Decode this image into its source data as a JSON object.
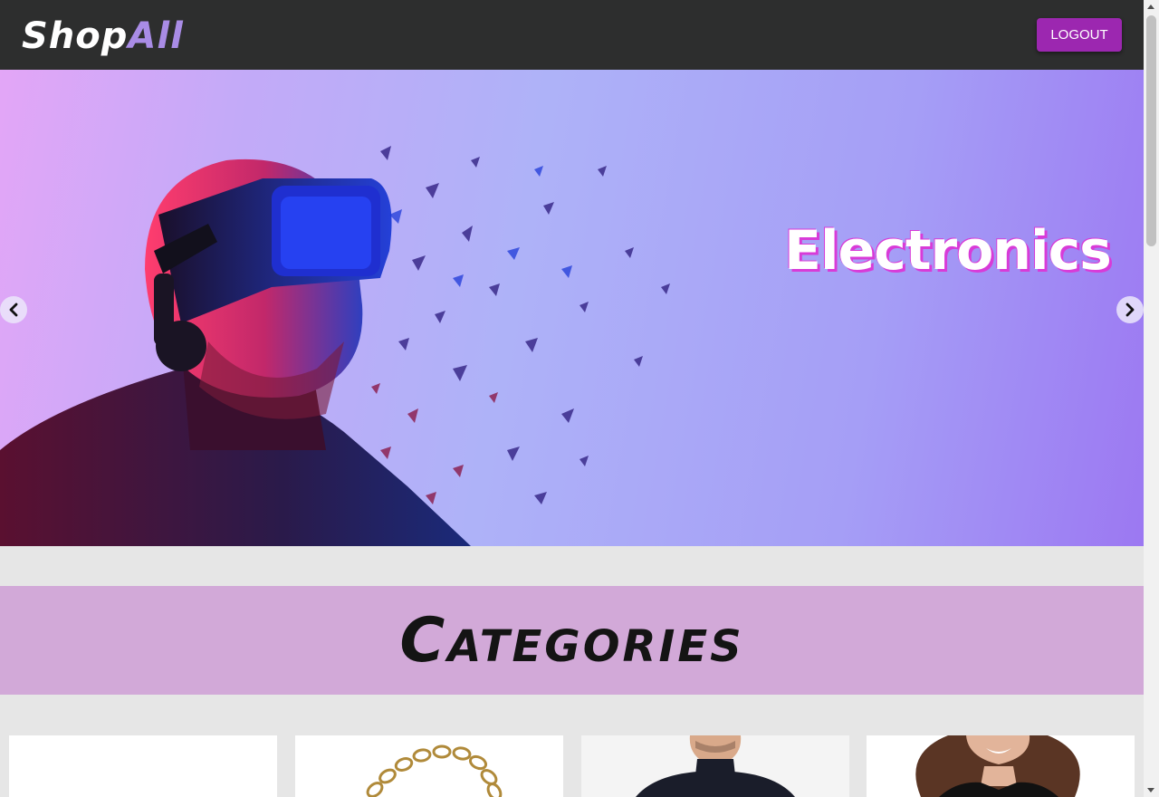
{
  "header": {
    "logo_part1": "Shop",
    "logo_part2": "All",
    "logout_label": "LOGOUT"
  },
  "hero": {
    "title": "Electronics",
    "prev_icon": "chevron-left-icon",
    "next_icon": "chevron-right-icon"
  },
  "categories": {
    "title": "Categories",
    "cards": [
      {
        "image": "blank"
      },
      {
        "image": "gold-chain-necklace"
      },
      {
        "image": "man-black-turtleneck"
      },
      {
        "image": "woman-black-top"
      }
    ]
  },
  "colors": {
    "header_bg": "#2d2e2e",
    "accent": "#9c27b0",
    "logo_accent": "#a98ce6",
    "categories_band": "#d2a9d8",
    "page_bg": "#e6e6e6"
  }
}
